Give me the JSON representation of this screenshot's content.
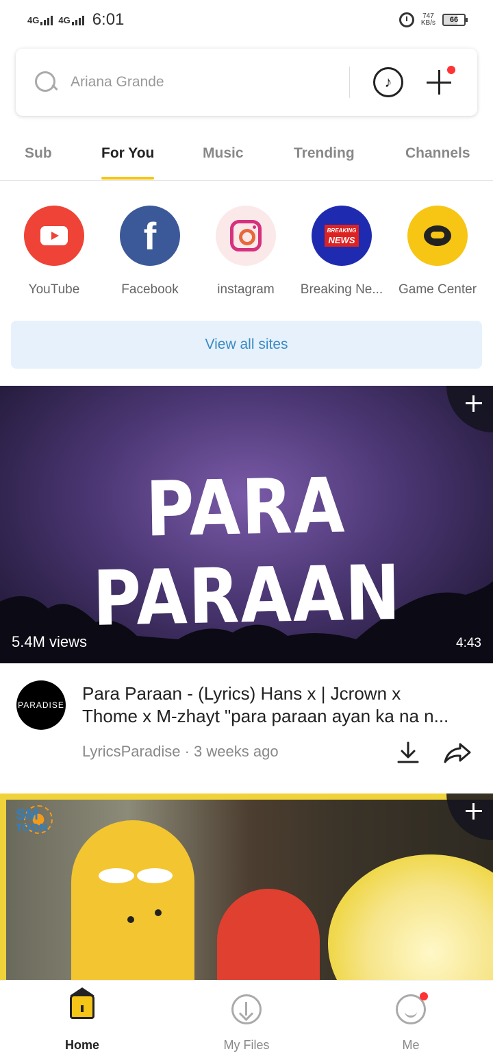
{
  "status_bar": {
    "network1": "4G",
    "network2": "4G",
    "time": "6:01",
    "speed_value": "747",
    "speed_unit": "KB/s",
    "battery": "66"
  },
  "search": {
    "placeholder": "Ariana Grande",
    "icons": [
      "search-icon",
      "music-note-icon",
      "plus-icon"
    ]
  },
  "tabs": [
    {
      "label": "Sub",
      "active": false
    },
    {
      "label": "For You",
      "active": true
    },
    {
      "label": "Music",
      "active": false
    },
    {
      "label": "Trending",
      "active": false
    },
    {
      "label": "Channels",
      "active": false
    }
  ],
  "sites": [
    {
      "name": "YouTube",
      "icon": "youtube-icon"
    },
    {
      "name": "Facebook",
      "icon": "facebook-icon"
    },
    {
      "name": "instagram",
      "icon": "instagram-icon"
    },
    {
      "name": "Breaking Ne...",
      "icon": "breaking-news-icon",
      "logo_text_1": "BREAKING",
      "logo_text_2": "NEWS"
    },
    {
      "name": "Game Center",
      "icon": "game-center-icon"
    }
  ],
  "view_all_label": "View all sites",
  "videos": [
    {
      "thumb_title": "PARA PARAAN",
      "views": "5.4M views",
      "duration": "4:43",
      "avatar_text": "PARADISE",
      "title_line1": "Para Paraan - (Lyrics) Hans x | Jcrown x",
      "title_line2": "Thome x M-zhayt \"para paraan ayan ka na n...",
      "channel": "LyricsParadise",
      "separator": "·",
      "age": "3 weeks ago"
    },
    {
      "brand_line1": "SM",
      "brand_line2": "TOON"
    }
  ],
  "bottom_nav": [
    {
      "label": "Home",
      "icon": "home-icon",
      "active": true
    },
    {
      "label": "My Files",
      "icon": "download-circle-icon",
      "active": false
    },
    {
      "label": "Me",
      "icon": "smiley-icon",
      "active": false
    }
  ],
  "colors": {
    "accent": "#f5c518",
    "link": "#3a8ac4",
    "youtube": "#ee4336",
    "facebook": "#3b5998",
    "notification": "#ff3333"
  }
}
